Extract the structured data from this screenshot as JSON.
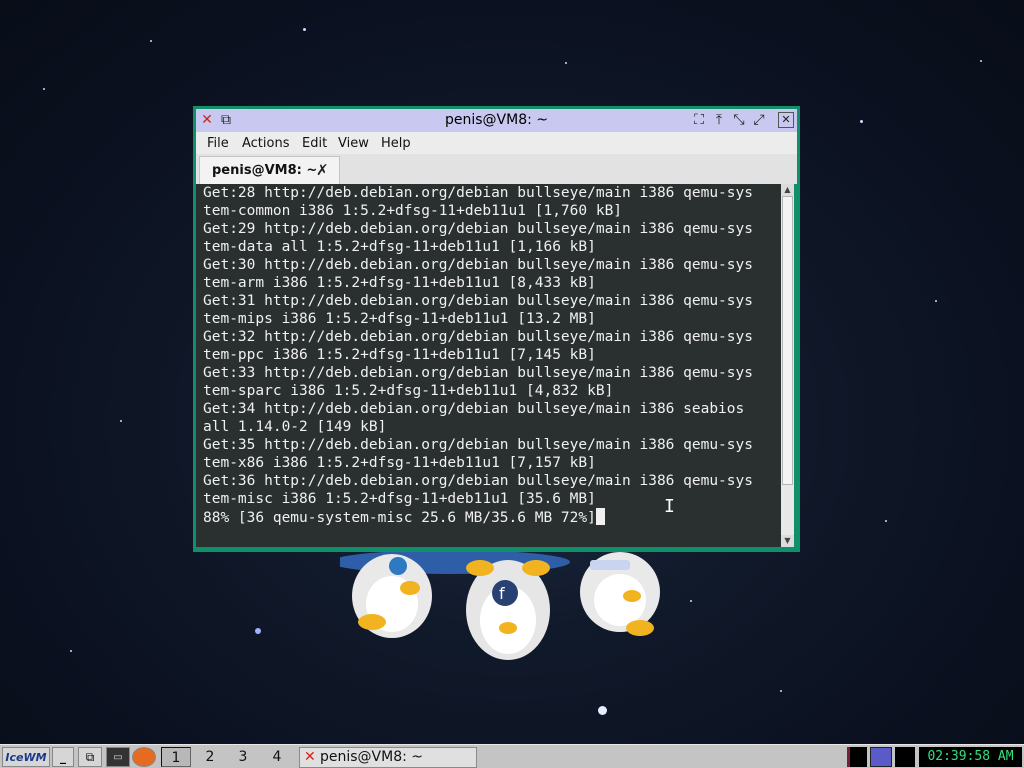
{
  "window": {
    "title": "penis@VM8: ~",
    "menu": [
      "File",
      "Actions",
      "Edit",
      "View",
      "Help"
    ],
    "tab_label": "penis@VM8: ~",
    "terminal_lines": [
      "Get:28 http://deb.debian.org/debian bullseye/main i386 qemu-sys",
      "tem-common i386 1:5.2+dfsg-11+deb11u1 [1,760 kB]",
      "Get:29 http://deb.debian.org/debian bullseye/main i386 qemu-sys",
      "tem-data all 1:5.2+dfsg-11+deb11u1 [1,166 kB]",
      "Get:30 http://deb.debian.org/debian bullseye/main i386 qemu-sys",
      "tem-arm i386 1:5.2+dfsg-11+deb11u1 [8,433 kB]",
      "Get:31 http://deb.debian.org/debian bullseye/main i386 qemu-sys",
      "tem-mips i386 1:5.2+dfsg-11+deb11u1 [13.2 MB]",
      "Get:32 http://deb.debian.org/debian bullseye/main i386 qemu-sys",
      "tem-ppc i386 1:5.2+dfsg-11+deb11u1 [7,145 kB]",
      "Get:33 http://deb.debian.org/debian bullseye/main i386 qemu-sys",
      "tem-sparc i386 1:5.2+dfsg-11+deb11u1 [4,832 kB]",
      "Get:34 http://deb.debian.org/debian bullseye/main i386 seabios",
      "all 1.14.0-2 [149 kB]",
      "Get:35 http://deb.debian.org/debian bullseye/main i386 qemu-sys",
      "tem-x86 i386 1:5.2+dfsg-11+deb11u1 [7,157 kB]",
      "Get:36 http://deb.debian.org/debian bullseye/main i386 qemu-sys",
      "tem-misc i386 1:5.2+dfsg-11+deb11u1 [35.6 MB]",
      "88% [36 qemu-system-misc 25.6 MB/35.6 MB 72%]"
    ]
  },
  "taskbar": {
    "logo": "IceWM",
    "workspaces": [
      "1",
      "2",
      "3",
      "4"
    ],
    "active_workspace": "1",
    "task_label": "penis@VM8: ~",
    "clock": "02:39:58 AM"
  },
  "colors": {
    "window_border": "#0f8f6a",
    "titlebar": "#c8c8f0",
    "terminal_bg": "#2a2f30",
    "terminal_fg": "#f0f0f0",
    "clock_fg": "#32e07a"
  }
}
